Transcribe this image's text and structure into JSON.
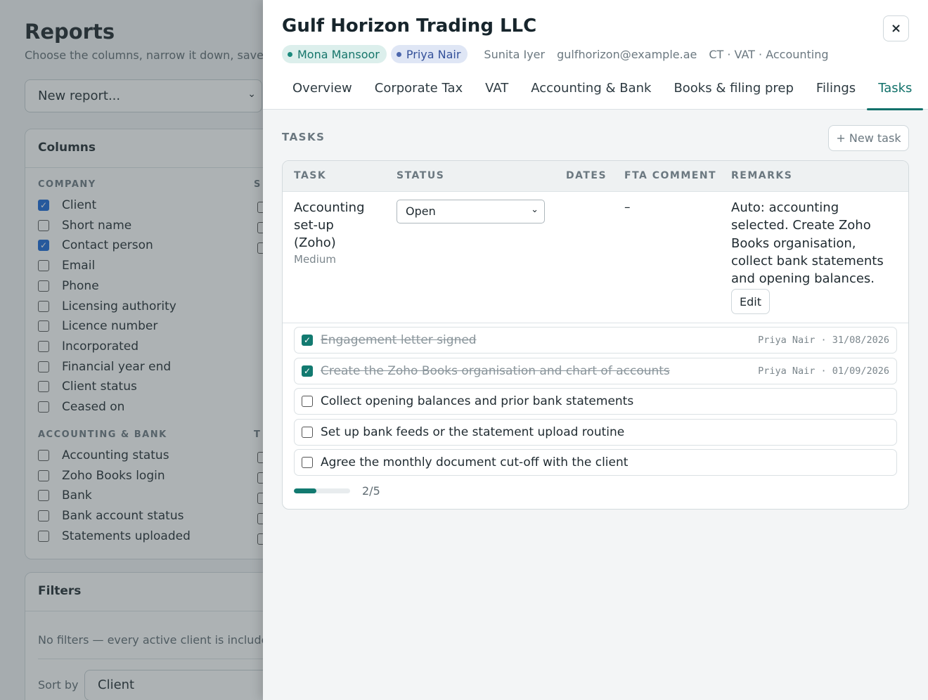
{
  "background": {
    "title": "Reports",
    "subtitle": "Choose the columns, narrow it down, save",
    "report_select": "New report...",
    "columns_card": {
      "heading": "Columns",
      "group1_label": "COMPANY",
      "group1_label2": "S",
      "group1": [
        {
          "label": "Client",
          "checked": true
        },
        {
          "label": "Short name",
          "checked": false
        },
        {
          "label": "Contact person",
          "checked": true
        },
        {
          "label": "Email",
          "checked": false
        },
        {
          "label": "Phone",
          "checked": false
        },
        {
          "label": "Licensing authority",
          "checked": false
        },
        {
          "label": "Licence number",
          "checked": false
        },
        {
          "label": "Incorporated",
          "checked": false
        },
        {
          "label": "Financial year end",
          "checked": false
        },
        {
          "label": "Client status",
          "checked": false
        },
        {
          "label": "Ceased on",
          "checked": false
        }
      ],
      "group2_label": "ACCOUNTING & BANK",
      "group2_label2": "T",
      "group2": [
        {
          "label": "Accounting status",
          "checked": false
        },
        {
          "label": "Zoho Books login",
          "checked": false
        },
        {
          "label": "Bank",
          "checked": false
        },
        {
          "label": "Bank account status",
          "checked": false
        },
        {
          "label": "Statements uploaded",
          "checked": false
        }
      ]
    },
    "filters_card": {
      "heading": "Filters",
      "empty_text": "No filters — every active client is include",
      "sort_label": "Sort by",
      "sort_value": "Client"
    }
  },
  "drawer": {
    "title": "Gulf Horizon Trading LLC",
    "close": "×",
    "chips": [
      {
        "label": "Mona Mansoor",
        "color": "#1a8a7d"
      },
      {
        "label": "Priya Nair",
        "color": "#4c67ad"
      }
    ],
    "meta": [
      "Sunita Iyer",
      "gulfhorizon@example.ae",
      "CT · VAT · Accounting"
    ],
    "tabs": [
      "Overview",
      "Corporate Tax",
      "VAT",
      "Accounting & Bank",
      "Books & filing prep",
      "Filings",
      "Tasks"
    ],
    "active_tab": "Tasks",
    "section_title": "TASKS",
    "new_task_label": "+ New task",
    "table": {
      "headers": [
        "TASK",
        "STATUS",
        "DATES",
        "FTA COMMENT",
        "REMARKS"
      ],
      "row": {
        "task": "Accounting set-up (Zoho)",
        "priority": "Medium",
        "status": "Open",
        "fta_comment": "–",
        "remarks": "Auto: accounting selected. Create Zoho Books organisation, collect bank statements and opening balances.",
        "edit_label": "Edit"
      },
      "subtasks": [
        {
          "text": "Engagement letter signed",
          "done": true,
          "meta": "Priya Nair · 31/08/2026"
        },
        {
          "text": "Create the Zoho Books organisation and chart of accounts",
          "done": true,
          "meta": "Priya Nair · 01/09/2026"
        },
        {
          "text": "Collect opening balances and prior bank statements",
          "done": false,
          "meta": ""
        },
        {
          "text": "Set up bank feeds or the statement upload routine",
          "done": false,
          "meta": ""
        },
        {
          "text": "Agree the monthly document cut-off with the client",
          "done": false,
          "meta": ""
        }
      ],
      "progress_text": "2/5",
      "progress_fraction": 0.4
    }
  },
  "colors": {
    "accent": "#127a70",
    "checkbox_blue": "#1866d6"
  }
}
